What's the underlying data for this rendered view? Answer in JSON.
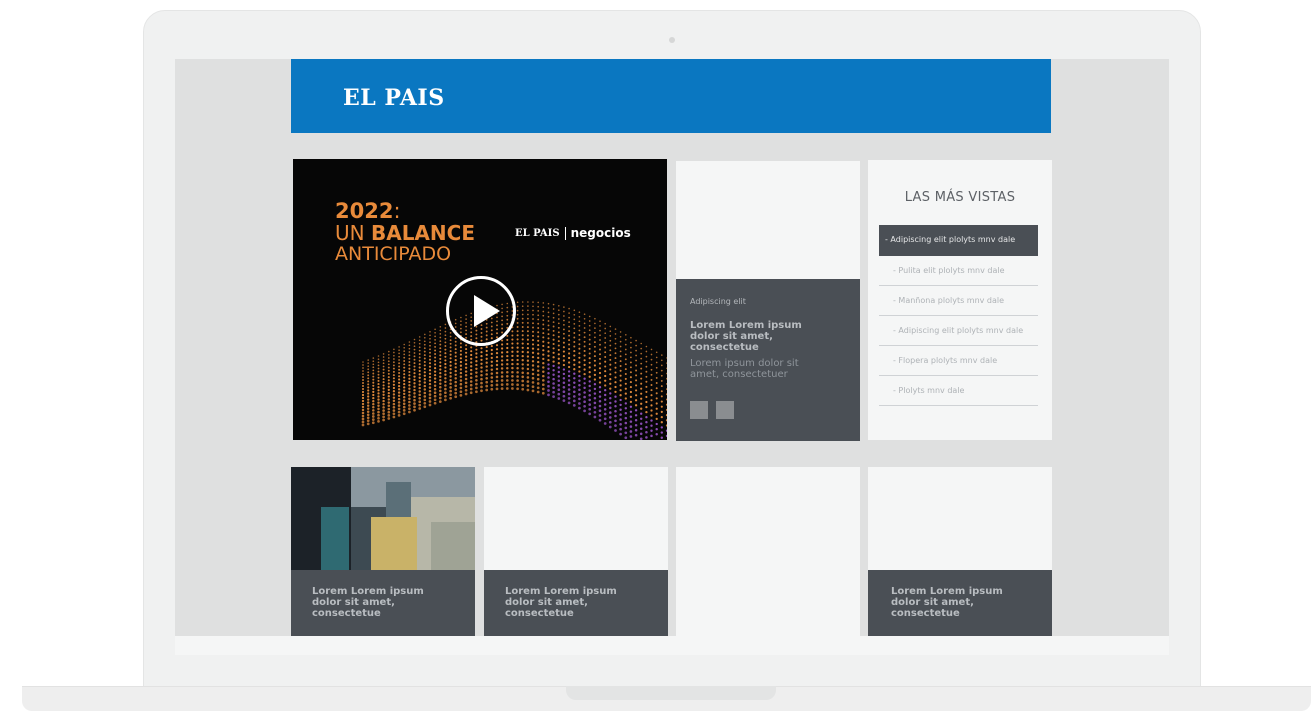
{
  "site": {
    "logo": "EL PAIS"
  },
  "video": {
    "year": "2022",
    "colon": ":",
    "line2_prefix": "UN ",
    "line2_bold": "BALANCE",
    "line3": "ANTICIPADO",
    "brand_logo": "EL PAIS",
    "brand_sub": "negocios",
    "colors": {
      "accent": "#e88a3a",
      "background": "#060606"
    }
  },
  "feature_card": {
    "kicker": "Adipiscing elit",
    "title": "Lorem Lorem ipsum dolor sit amet, consectetue",
    "description": "Lorem ipsum dolor sit amet, consectetuer"
  },
  "most_viewed": {
    "title": "LAS MÁS VISTAS",
    "items": [
      {
        "label": "-  Adipiscing elit plolyts mnv dale",
        "active": true
      },
      {
        "label": "-  Pulita elit plolyts mnv dale",
        "active": false
      },
      {
        "label": "-  Manñona plolyts mnv dale",
        "active": false
      },
      {
        "label": "-  Adipiscing elit plolyts mnv dale",
        "active": false
      },
      {
        "label": "-  Flopera plolyts mnv dale",
        "active": false
      },
      {
        "label": "-  Plolyts mnv dale",
        "active": false
      }
    ]
  },
  "bottom_cards": [
    {
      "title": "Lorem Lorem ipsum dolor sit amet, consectetue",
      "has_image": true
    },
    {
      "title": "Lorem Lorem ipsum dolor sit amet, consectetue",
      "has_image": false
    },
    {
      "title": "",
      "has_image": false
    },
    {
      "title": "Lorem Lorem ipsum dolor sit amet, consectetue",
      "has_image": false
    }
  ],
  "theme": {
    "header_blue": "#0a77c1",
    "card_dark": "#4a4f55",
    "card_light": "#f5f6f6",
    "screen_bg": "#dfe0e0"
  }
}
